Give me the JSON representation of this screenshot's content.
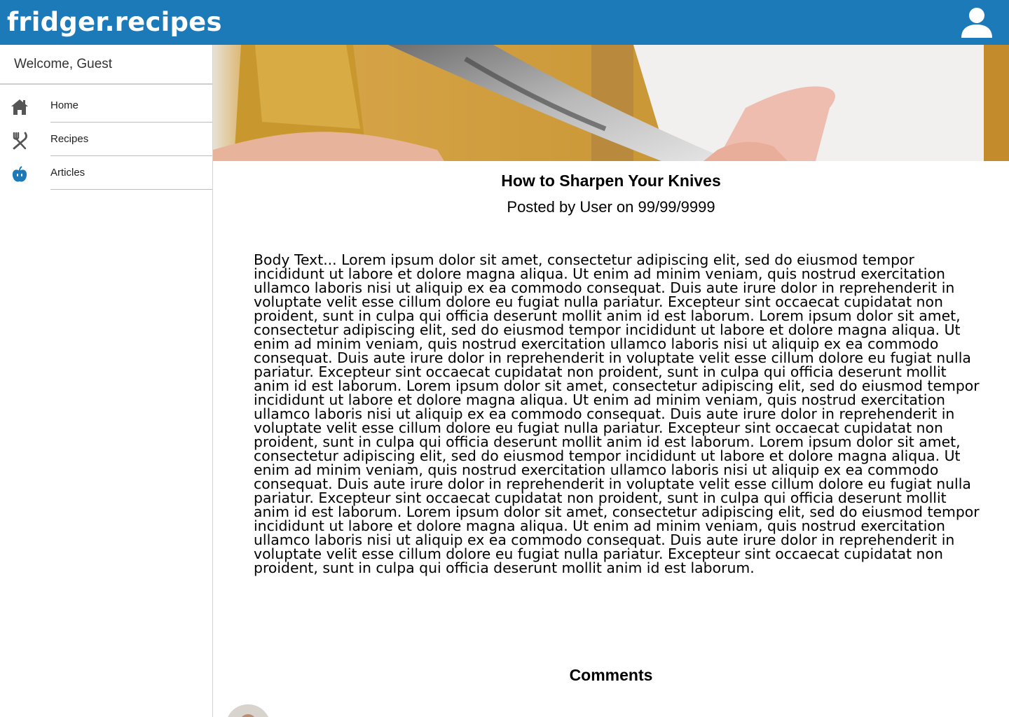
{
  "header": {
    "brand": "fridger.recipes",
    "account_icon": "user-icon",
    "color": "#1d7ab8"
  },
  "sidebar": {
    "welcome": "Welcome, Guest",
    "items": [
      {
        "label": "Home",
        "icon": "home-icon"
      },
      {
        "label": "Recipes",
        "icon": "utensils-icon"
      },
      {
        "label": "Articles",
        "icon": "apple-icon"
      }
    ]
  },
  "article": {
    "title": "How to Sharpen Your Knives",
    "meta": "Posted by User on 99/99/9999",
    "body": "Body Text...  Lorem ipsum dolor sit amet, consectetur adipiscing elit, sed do eiusmod tempor incididunt ut labore et dolore magna aliqua. Ut enim ad minim veniam, quis nostrud exercitation ullamco laboris nisi ut aliquip ex ea commodo consequat. Duis aute irure dolor in reprehenderit in voluptate velit esse cillum dolore eu fugiat nulla pariatur. Excepteur sint occaecat cupidatat non proident, sunt in culpa qui officia deserunt mollit anim id est laborum.  Lorem ipsum dolor sit amet, consectetur adipiscing elit, sed do eiusmod tempor incididunt ut labore et dolore magna aliqua. Ut enim ad minim veniam, quis nostrud exercitation ullamco laboris nisi ut aliquip ex ea commodo consequat. Duis aute irure dolor in reprehenderit in voluptate velit esse cillum dolore eu fugiat nulla pariatur. Excepteur sint occaecat cupidatat non proident, sunt in culpa qui officia deserunt mollit anim id est laborum.  Lorem ipsum dolor sit amet, consectetur adipiscing elit, sed do eiusmod tempor incididunt ut labore et dolore magna aliqua. Ut enim ad minim veniam, quis nostrud exercitation ullamco laboris nisi ut aliquip ex ea commodo consequat. Duis aute irure dolor in reprehenderit in voluptate velit esse cillum dolore eu fugiat nulla pariatur. Excepteur sint occaecat cupidatat non proident, sunt in culpa qui officia deserunt mollit anim id est laborum.  Lorem ipsum dolor sit amet, consectetur adipiscing elit, sed do eiusmod tempor incididunt ut labore et dolore magna aliqua. Ut enim ad minim veniam, quis nostrud exercitation ullamco laboris nisi ut aliquip ex ea commodo consequat. Duis aute irure dolor in reprehenderit in voluptate velit esse cillum dolore eu fugiat nulla pariatur. Excepteur sint occaecat cupidatat non proident, sunt in culpa qui officia deserunt mollit anim id est laborum.  Lorem ipsum dolor sit amet, consectetur adipiscing elit, sed do eiusmod tempor incididunt ut labore et dolore magna aliqua. Ut enim ad minim veniam, quis nostrud exercitation ullamco laboris nisi ut aliquip ex ea commodo consequat. Duis aute irure dolor in reprehenderit in voluptate velit esse cillum dolore eu fugiat nulla pariatur. Excepteur sint occaecat cupidatat non proident, sunt in culpa qui officia deserunt mollit anim id est laborum."
  },
  "comments": {
    "title": "Comments"
  }
}
